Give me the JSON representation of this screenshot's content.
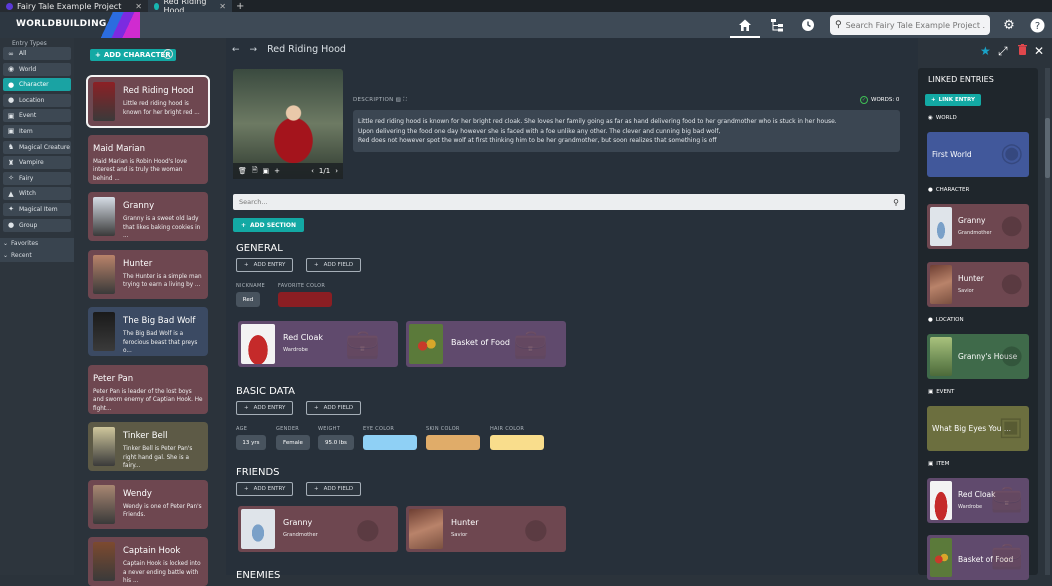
{
  "tabs": [
    {
      "label": "Fairy Tale Example Project",
      "close": "✕"
    },
    {
      "label": "Red Riding Hood",
      "close": "✕"
    }
  ],
  "new_tab": "+",
  "brand": "WORLDBUILDING",
  "search": {
    "placeholder": "Search Fairy Tale Example Project ..."
  },
  "sidebar": {
    "header": "Entry Types",
    "items": [
      {
        "label": "All",
        "icon": "infinity-icon"
      },
      {
        "label": "World",
        "icon": "globe-icon"
      },
      {
        "label": "Character",
        "icon": "person-icon",
        "active": true
      },
      {
        "label": "Location",
        "icon": "pin-icon"
      },
      {
        "label": "Event",
        "icon": "calendar-icon"
      },
      {
        "label": "Item",
        "icon": "bag-icon"
      },
      {
        "label": "Magical Creature",
        "icon": "unicorn-icon"
      },
      {
        "label": "Vampire",
        "icon": "vampire-icon"
      },
      {
        "label": "Fairy",
        "icon": "fairy-icon"
      },
      {
        "label": "Witch",
        "icon": "witch-icon"
      },
      {
        "label": "Magical Item",
        "icon": "wand-icon"
      },
      {
        "label": "Group",
        "icon": "group-icon"
      }
    ],
    "favorites": "Favorites",
    "recent": "Recent"
  },
  "list": {
    "add_button": "ADD CHARACTER",
    "cards": [
      {
        "name": "Red Riding Hood",
        "desc": "Little red riding hood is known for her bright red ...",
        "color": "#6e4750",
        "thumb": "#8c2025"
      },
      {
        "name": "Maid Marian",
        "desc": "Maid Marian is Robin Hood's love interest and is truly the woman behind ...",
        "color": "#6e4750",
        "thumb": ""
      },
      {
        "name": "Granny",
        "desc": "Granny is a sweet old lady that likes baking cookies in ...",
        "color": "#6e4750",
        "thumb": "#d6dde6"
      },
      {
        "name": "Hunter",
        "desc": "The Hunter is a simple man trying to earn a living by ...",
        "color": "#6e4750",
        "thumb": "#b9836a"
      },
      {
        "name": "The Big Bad Wolf",
        "desc": "The Big Bad Wolf is a ferocious beast that preys o...",
        "color": "#3b4a63",
        "thumb": "#1a1a1a"
      },
      {
        "name": "Peter Pan",
        "desc": "Peter Pan is leader of the lost boys and sworn enemy of Captian Hook. He fight...",
        "color": "#6e4750",
        "thumb": ""
      },
      {
        "name": "Tinker Bell",
        "desc": "Tinker Bell is Peter Pan's right hand gal. She is a fairy...",
        "color": "#5d5a46",
        "thumb": "#cfc79c"
      },
      {
        "name": "Wendy",
        "desc": "Wendy is one of Peter Pan's Friends.",
        "color": "#6e4750",
        "thumb": "#a88772"
      },
      {
        "name": "Captain Hook",
        "desc": "Captain Hook is locked into a never ending battle with his ...",
        "color": "#6e4750",
        "thumb": "#7d4a2f"
      }
    ]
  },
  "entry": {
    "title": "Red Riding Hood",
    "image_page": "1/1",
    "description_label": "DESCRIPTION",
    "words": "WORDS: 0",
    "description_lines": [
      "Little red riding hood is known for her bright red cloak. She loves her family going as far as hand delivering food to her grandmother who is stuck in her house.",
      "Upon delivering the food one day however she is faced with a foe unlike any other. The clever and cunning big bad wolf,",
      "Red does not however spot the wolf at first thinking him to be her grandmother, but soon realizes that something is off"
    ],
    "search_placeholder": "Search...",
    "add_section": "ADD SECTION",
    "add_entry": "ADD ENTRY",
    "add_field": "ADD FIELD",
    "sections": [
      {
        "title": "GENERAL",
        "fields": [
          {
            "label": "NICKNAME",
            "value": "Red"
          },
          {
            "label": "FAVORITE COLOR",
            "value": "",
            "color": "#8b1e23"
          }
        ],
        "links": [
          {
            "name": "Red Cloak",
            "sub": "Wardrobe",
            "thumb": "#c52a2a"
          },
          {
            "name": "Basket of Food",
            "sub": "",
            "thumb": "#5b7a3a"
          }
        ]
      },
      {
        "title": "BASIC DATA",
        "fields": [
          {
            "label": "AGE",
            "value": "13 yrs"
          },
          {
            "label": "GENDER",
            "value": "Female"
          },
          {
            "label": "WEIGHT",
            "value": "95.0 lbs"
          },
          {
            "label": "EYE COLOR",
            "value": "",
            "color": "#8fd0f5"
          },
          {
            "label": "SKIN COLOR",
            "value": "",
            "color": "#e0ac69"
          },
          {
            "label": "HAIR COLOR",
            "value": "",
            "color": "#f9dd8c"
          }
        ]
      },
      {
        "title": "FRIENDS",
        "links": [
          {
            "name": "Granny",
            "sub": "Grandmother",
            "thumb": "#d6dde6"
          },
          {
            "name": "Hunter",
            "sub": "Savior",
            "thumb": "#b9836a"
          }
        ]
      }
    ],
    "next_section_partial": "ENEMIES"
  },
  "linked": {
    "title": "LINKED ENTRIES",
    "button": "LINK ENTRY",
    "groups": [
      {
        "label": "WORLD",
        "icon": "globe-icon",
        "cards": [
          {
            "name": "First World",
            "sub": "",
            "color": "#41589b",
            "thumb": ""
          }
        ]
      },
      {
        "label": "CHARACTER",
        "icon": "person-icon",
        "cards": [
          {
            "name": "Granny",
            "sub": "Grandmother",
            "color": "#6e4750",
            "thumb": "#d6dde6"
          },
          {
            "name": "Hunter",
            "sub": "Savior",
            "color": "#6e4750",
            "thumb": "#b9836a"
          }
        ]
      },
      {
        "label": "LOCATION",
        "icon": "pin-icon",
        "cards": [
          {
            "name": "Granny's House",
            "sub": "",
            "color": "#3f6a4a",
            "thumb": "#6f8d55"
          }
        ]
      },
      {
        "label": "EVENT",
        "icon": "calendar-icon",
        "cards": [
          {
            "name": "What Big Eyes You ...",
            "sub": "",
            "color": "#6c6f3f",
            "thumb": ""
          }
        ]
      },
      {
        "label": "ITEM",
        "icon": "bag-icon",
        "cards": [
          {
            "name": "Red Cloak",
            "sub": "Wardrobe",
            "color": "#604a6d",
            "thumb": "#c52a2a"
          },
          {
            "name": "Basket of Food",
            "sub": "",
            "color": "#604a6d",
            "thumb": "#5b7a3a"
          }
        ]
      }
    ]
  },
  "colors": {
    "accent": "#13a9a4",
    "favorite_star": "#1aa3c8",
    "delete": "#e0474c"
  }
}
